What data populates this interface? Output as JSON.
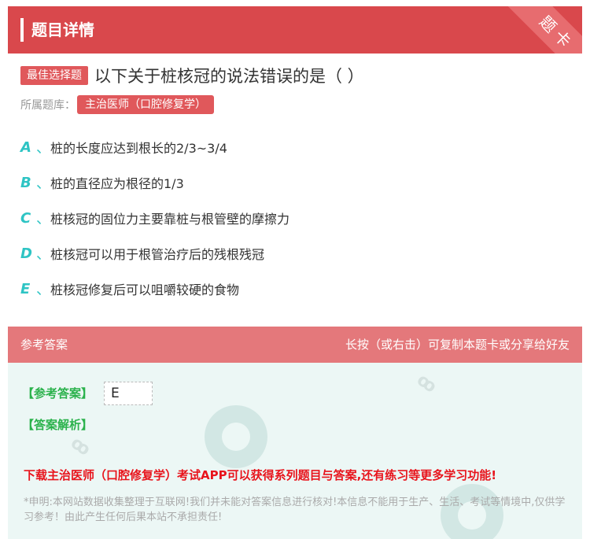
{
  "header": {
    "title": "题目详情",
    "corner_label": "题卡"
  },
  "question": {
    "type_tag": "最佳选择题",
    "text": "以下关于桩核冠的说法错误的是（ ）",
    "bank_label": "所属题库：",
    "bank_name": "主治医师（口腔修复学）"
  },
  "options": [
    {
      "letter": "A",
      "sep": "、",
      "text": "桩的长度应达到根长的2/3~3/4"
    },
    {
      "letter": "B",
      "sep": "、",
      "text": "桩的直径应为根径的1/3"
    },
    {
      "letter": "C",
      "sep": "、",
      "text": "桩核冠的固位力主要靠桩与根管壁的摩擦力"
    },
    {
      "letter": "D",
      "sep": "、",
      "text": "桩核冠可以用于根管治疗后的残根残冠"
    },
    {
      "letter": "E",
      "sep": "、",
      "text": "桩核冠修复后可以咀嚼较硬的食物"
    }
  ],
  "answer": {
    "head_left": "参考答案",
    "head_right": "长按（或右击）可复制本题卡或分享给好友",
    "answer_label": "【参考答案】",
    "answer_value": "E",
    "analysis_label": "【答案解析】",
    "download_text": "下载主治医师（口腔修复学）考试APP可以获得系列题目与答案,还有练习等更多学习功能!",
    "disclaimer": "*申明:本网站数据收集整理于互联网!我们并未能对答案信息进行核对!本信息不能用于生产、生活、考试等情境中,仅供学习参考！由此产生任何后果本站不承担责任!"
  },
  "colors": {
    "header_red": "#d9484c",
    "answer_head": "#e4787b",
    "option_letter": "#2ec4c4",
    "answer_green": "#2bb24c",
    "download_red": "#e8141c"
  }
}
